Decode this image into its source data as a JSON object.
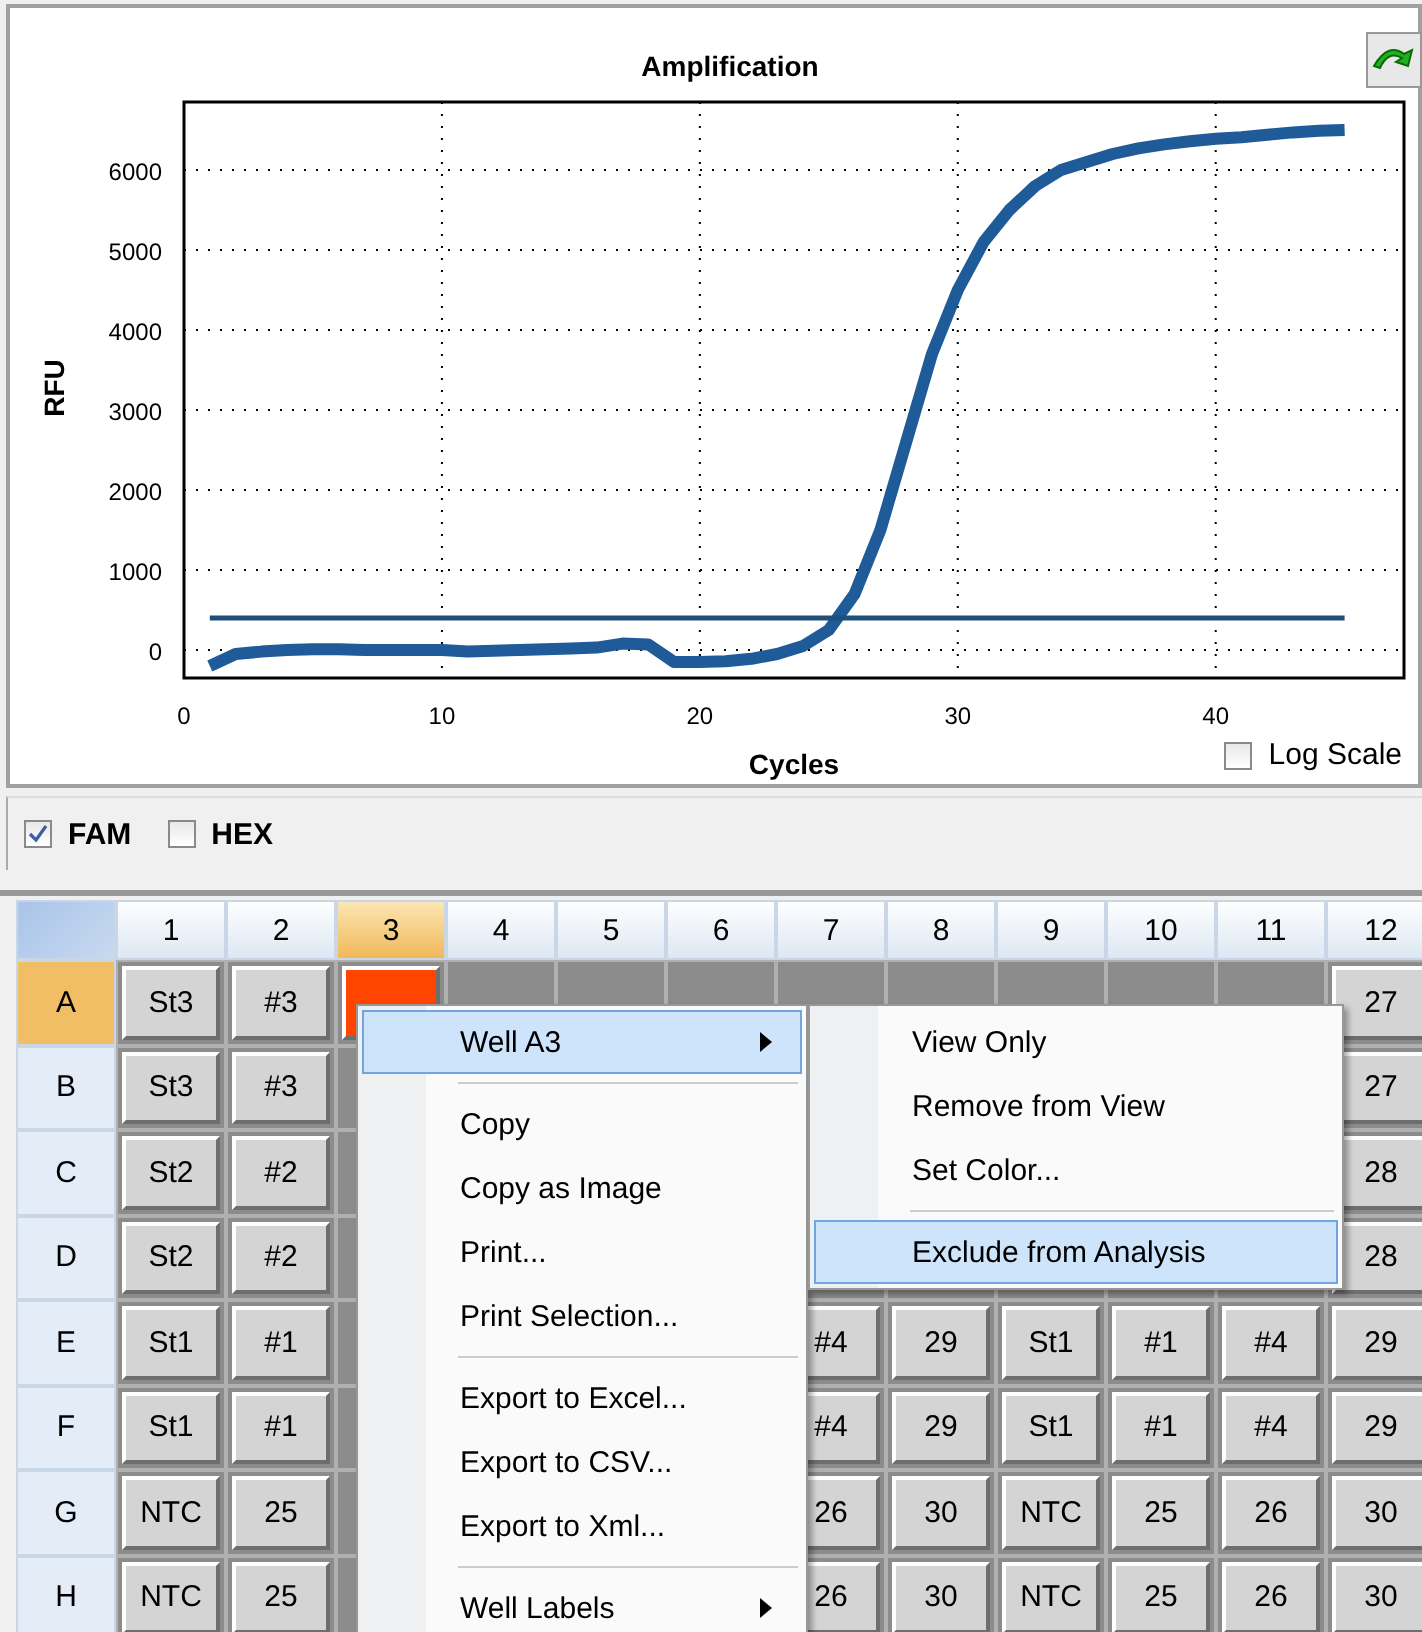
{
  "chart": {
    "chart_data": {
      "type": "line",
      "title": "Amplification",
      "xlabel": "Cycles",
      "ylabel": "RFU",
      "x": [
        1,
        2,
        3,
        4,
        5,
        6,
        7,
        8,
        9,
        10,
        11,
        12,
        13,
        14,
        15,
        16,
        17,
        18,
        19,
        20,
        21,
        22,
        23,
        24,
        25,
        26,
        27,
        28,
        29,
        30,
        31,
        32,
        33,
        34,
        35,
        36,
        37,
        38,
        39,
        40,
        41,
        42,
        43,
        44,
        45
      ],
      "series": [
        {
          "color": "#1f5b99",
          "values": [
            -200,
            -50,
            -20,
            0,
            10,
            10,
            0,
            0,
            0,
            0,
            -20,
            -10,
            0,
            10,
            20,
            30,
            80,
            70,
            -150,
            -150,
            -140,
            -110,
            -50,
            50,
            250,
            700,
            1500,
            2600,
            3700,
            4500,
            5100,
            5500,
            5800,
            6000,
            6100,
            6200,
            6270,
            6320,
            6360,
            6390,
            6410,
            6440,
            6470,
            6490,
            6500
          ]
        },
        {
          "color": "#1f4e79",
          "values": [
            400,
            400,
            400,
            400,
            400,
            400,
            400,
            400,
            400,
            400,
            400,
            400,
            400,
            400,
            400,
            400,
            400,
            400,
            400,
            400,
            400,
            400,
            400,
            400,
            400,
            400,
            400,
            400,
            400,
            400,
            400,
            400,
            400,
            400,
            400,
            400,
            400,
            400,
            400,
            400,
            400,
            400,
            400,
            400,
            400
          ]
        }
      ],
      "xlim": [
        0,
        47.3
      ],
      "ylim": [
        -350,
        6850
      ],
      "xticks": [
        0,
        10,
        20,
        30,
        40
      ],
      "yticks": [
        0,
        1000,
        2000,
        3000,
        4000,
        5000,
        6000
      ],
      "grid": true
    },
    "log_scale": {
      "label": "Log Scale",
      "checked": false
    }
  },
  "fluorophores": [
    {
      "label": "FAM",
      "checked": true
    },
    {
      "label": "HEX",
      "checked": false
    }
  ],
  "plate": {
    "columns": [
      {
        "label": "1",
        "selected": false
      },
      {
        "label": "2",
        "selected": false
      },
      {
        "label": "3",
        "selected": true
      },
      {
        "label": "4",
        "selected": false
      },
      {
        "label": "5",
        "selected": false
      },
      {
        "label": "6",
        "selected": false
      },
      {
        "label": "7",
        "selected": false
      },
      {
        "label": "8",
        "selected": false
      },
      {
        "label": "9",
        "selected": false
      },
      {
        "label": "10",
        "selected": false
      },
      {
        "label": "11",
        "selected": false
      },
      {
        "label": "12",
        "selected": false
      }
    ],
    "rows": [
      {
        "label": "A",
        "selected": true,
        "cells": [
          "St3",
          "#3",
          null,
          null,
          null,
          null,
          null,
          null,
          null,
          null,
          null,
          "27"
        ]
      },
      {
        "label": "B",
        "selected": false,
        "cells": [
          "St3",
          "#3",
          null,
          null,
          null,
          null,
          null,
          null,
          null,
          null,
          null,
          "27"
        ]
      },
      {
        "label": "C",
        "selected": false,
        "cells": [
          "St2",
          "#2",
          null,
          null,
          null,
          null,
          null,
          null,
          null,
          null,
          null,
          "28"
        ]
      },
      {
        "label": "D",
        "selected": false,
        "cells": [
          "St2",
          "#2",
          null,
          null,
          null,
          null,
          null,
          null,
          null,
          null,
          null,
          "28"
        ]
      },
      {
        "label": "E",
        "selected": false,
        "cells": [
          "St1",
          "#1",
          null,
          null,
          null,
          null,
          "#4",
          "29",
          "St1",
          "#1",
          "#4",
          "29"
        ]
      },
      {
        "label": "F",
        "selected": false,
        "cells": [
          "St1",
          "#1",
          null,
          null,
          null,
          null,
          "#4",
          "29",
          "St1",
          "#1",
          "#4",
          "29"
        ]
      },
      {
        "label": "G",
        "selected": false,
        "cells": [
          "NTC",
          "25",
          null,
          null,
          null,
          null,
          "26",
          "30",
          "NTC",
          "25",
          "26",
          "30"
        ]
      },
      {
        "label": "H",
        "selected": false,
        "cells": [
          "NTC",
          "25",
          null,
          null,
          null,
          null,
          "26",
          "30",
          "NTC",
          "25",
          "26",
          "30"
        ]
      }
    ]
  },
  "context_menu": {
    "items": [
      {
        "kind": "item",
        "label": "Well A3",
        "selected": true,
        "submenu": true
      },
      {
        "kind": "separator"
      },
      {
        "kind": "item",
        "label": "Copy",
        "selected": false,
        "submenu": false
      },
      {
        "kind": "item",
        "label": "Copy as Image",
        "selected": false,
        "submenu": false
      },
      {
        "kind": "item",
        "label": "Print...",
        "selected": false,
        "submenu": false
      },
      {
        "kind": "item",
        "label": "Print Selection...",
        "selected": false,
        "submenu": false
      },
      {
        "kind": "separator"
      },
      {
        "kind": "item",
        "label": "Export to Excel...",
        "selected": false,
        "submenu": false
      },
      {
        "kind": "item",
        "label": "Export to CSV...",
        "selected": false,
        "submenu": false
      },
      {
        "kind": "item",
        "label": "Export to Xml...",
        "selected": false,
        "submenu": false
      },
      {
        "kind": "separator"
      },
      {
        "kind": "item",
        "label": "Well Labels",
        "selected": false,
        "submenu": true
      }
    ]
  },
  "submenu": {
    "items": [
      {
        "kind": "item",
        "label": "View Only",
        "selected": false
      },
      {
        "kind": "item",
        "label": "Remove from View",
        "selected": false
      },
      {
        "kind": "item",
        "label": "Set Color...",
        "selected": false
      },
      {
        "kind": "separator"
      },
      {
        "kind": "item",
        "label": "Exclude from Analysis",
        "selected": true
      }
    ]
  }
}
